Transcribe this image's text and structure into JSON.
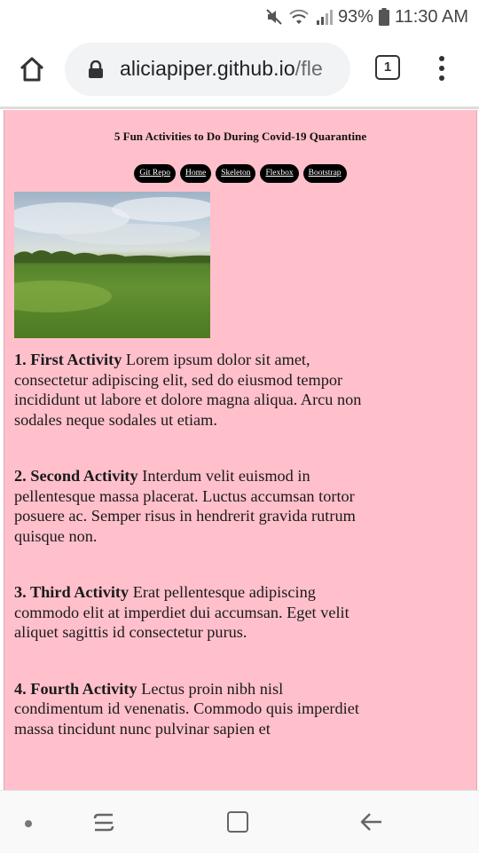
{
  "status_bar": {
    "battery": "93%",
    "time": "11:30 AM",
    "icons": [
      "mute-icon",
      "wifi-icon",
      "signal-icon",
      "battery-icon"
    ]
  },
  "browser": {
    "url_host": "aliciapiper.github.io",
    "url_path": "/fle",
    "tab_count": "1",
    "icons": [
      "home-icon",
      "lock-icon",
      "tabs-icon",
      "more-vert-icon"
    ]
  },
  "page": {
    "background": "#ffc0cb",
    "title": "5 Fun Activities to Do During Covid-19 Quarantine",
    "nav": [
      "Git Repo",
      "Home",
      "Skeleton",
      "Flexbox",
      "Bootstrap"
    ],
    "activities": [
      {
        "heading": "1. First Activity",
        "text": "Lorem ipsum dolor sit amet, consectetur adipiscing elit, sed do eiusmod tempor incididunt ut labore et dolore magna aliqua. Arcu non sodales neque sodales ut etiam."
      },
      {
        "heading": "2. Second Activity",
        "text": "Interdum velit euismod in pellentesque massa placerat. Luctus accumsan tortor posuere ac. Semper risus in hendrerit gravida rutrum quisque non."
      },
      {
        "heading": "3. Third Activity",
        "text": "Erat pellentesque adipiscing commodo elit at imperdiet dui accumsan. Eget velit aliquet sagittis id consectetur purus."
      },
      {
        "heading": "4. Fourth Activity",
        "text": "Lectus proin nibh nisl condimentum id venenatis. Commodo quis imperdiet massa tincidunt nunc pulvinar sapien et"
      }
    ]
  },
  "android_nav": {
    "icons": [
      "dot-icon",
      "recent-apps-icon",
      "home-square-icon",
      "back-arrow-icon"
    ]
  }
}
